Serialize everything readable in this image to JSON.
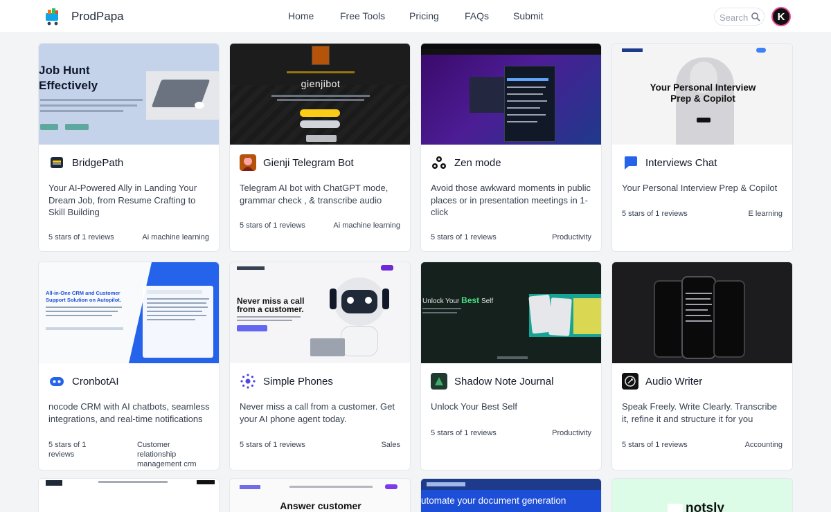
{
  "header": {
    "brand": "ProdPapa",
    "nav": [
      "Home",
      "Free Tools",
      "Pricing",
      "FAQs",
      "Submit"
    ],
    "search_placeholder": "Search",
    "avatar_letter": "K"
  },
  "cards": [
    {
      "title": "BridgePath",
      "description": "Your AI-Powered Ally in Landing Your Dream Job, from Resume Crafting to Skill Building",
      "rating": "5 stars of 1 reviews",
      "tag": "Ai machine learning",
      "shot_text": [
        "Job Hunt",
        "Effectively"
      ]
    },
    {
      "title": "Gienji Telegram Bot",
      "description": "Telegram AI bot with ChatGPT mode, grammar check , & transcribe audio",
      "rating": "5 stars of 1 reviews",
      "tag": "Ai machine learning",
      "shot_text": [
        "gienjibot"
      ]
    },
    {
      "title": "Zen mode",
      "description": "Avoid those awkward moments in public places or in presentation meetings in 1-click",
      "rating": "5 stars of 1 reviews",
      "tag": "Productivity",
      "shot_text": []
    },
    {
      "title": "Interviews Chat",
      "description": "Your Personal Interview Prep & Copilot",
      "rating": "5 stars of 1 reviews",
      "tag": "E learning",
      "shot_text": [
        "Your Personal Interview",
        "Prep & Copilot"
      ]
    },
    {
      "title": "CronbotAI",
      "description": "nocode CRM with AI chatbots, seamless integrations, and real-time notifications",
      "rating": "5 stars of 1 reviews",
      "tag": "Customer relationship management crm",
      "shot_text": [
        "All-in-One CRM and Customer",
        "Support Solution on Autopilot."
      ]
    },
    {
      "title": "Simple Phones",
      "description": "Never miss a call from a customer. Get your AI phone agent today.",
      "rating": "5 stars of 1 reviews",
      "tag": "Sales",
      "shot_text": [
        "Never miss a call",
        "from a customer."
      ]
    },
    {
      "title": "Shadow Note Journal",
      "description": "Unlock Your Best Self",
      "rating": "5 stars of 1 reviews",
      "tag": "Productivity",
      "shot_text": [
        "Unlock Your",
        "Best",
        "Self"
      ]
    },
    {
      "title": "Audio Writer",
      "description": "Speak Freely. Write Clearly. Transcribe it, refine it and structure it for you",
      "rating": "5 stars of 1 reviews",
      "tag": "Accounting",
      "shot_text": []
    }
  ],
  "partial_cards": [
    {
      "shot_text": ""
    },
    {
      "shot_text": "Answer customer"
    },
    {
      "shot_text": "utomate your document generation"
    },
    {
      "shot_text": "notsly"
    }
  ],
  "colors": {
    "page_bg": "#f3f4f6",
    "accent_blue": "#2563eb",
    "avatar_ring": "#ec4899"
  }
}
